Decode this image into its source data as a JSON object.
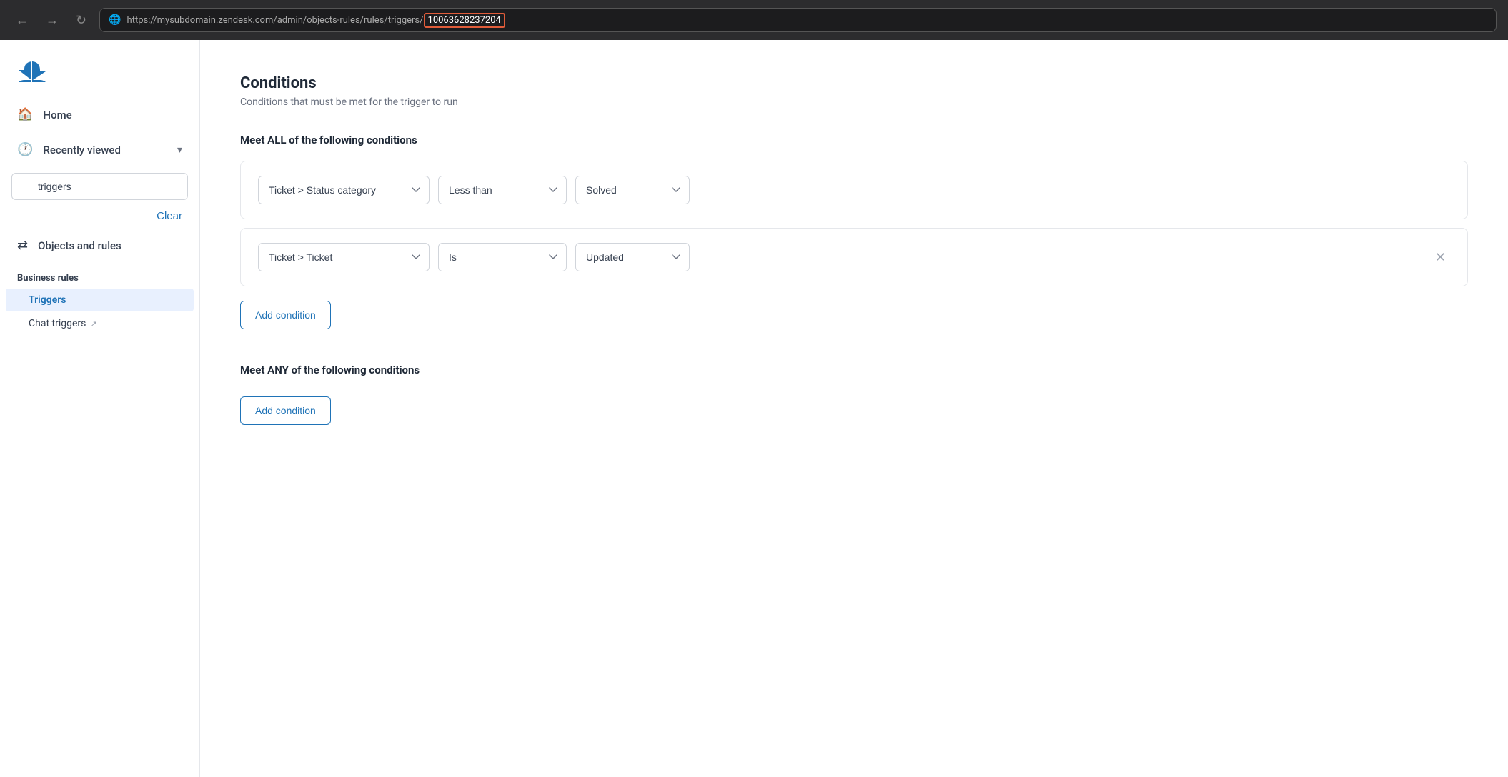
{
  "browser": {
    "back_icon": "←",
    "forward_icon": "→",
    "refresh_icon": "↻",
    "url_prefix": "https://mysubdomain.zendesk.com/admin/objects-rules/rules/triggers/",
    "url_highlight": "10063628237204"
  },
  "sidebar": {
    "logo_alt": "Zendesk",
    "home_label": "Home",
    "recently_viewed_label": "Recently viewed",
    "search_placeholder": "triggers",
    "search_value": "triggers",
    "clear_label": "Clear",
    "objects_and_rules_label": "Objects and rules",
    "business_rules_label": "Business rules",
    "triggers_label": "Triggers",
    "chat_triggers_label": "Chat triggers"
  },
  "main": {
    "conditions_title": "Conditions",
    "conditions_subtitle": "Conditions that must be met for the trigger to run",
    "meet_all_label": "Meet ALL of the following conditions",
    "meet_any_label": "Meet ANY of the following conditions",
    "condition1": {
      "field": "Ticket > Status category",
      "operator": "Less than",
      "value": "Solved"
    },
    "condition2": {
      "field": "Ticket > Ticket",
      "operator": "Is",
      "value": "Updated"
    },
    "add_condition_label": "Add condition",
    "add_condition_any_label": "Add condition"
  }
}
